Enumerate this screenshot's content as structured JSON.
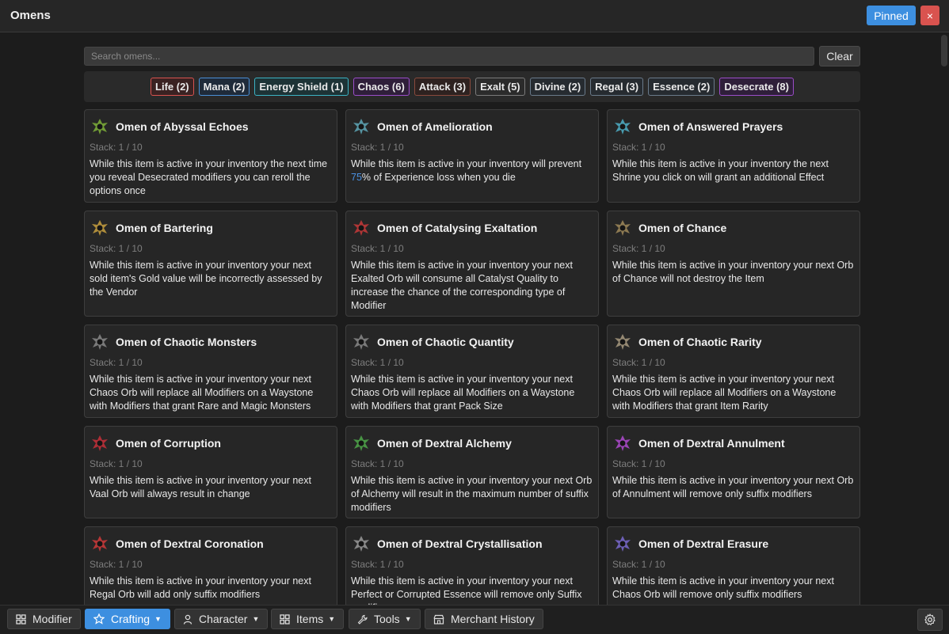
{
  "app": {
    "title": "Omens",
    "pinned_label": "Pinned",
    "close_label": "×"
  },
  "search": {
    "placeholder": "Search omens...",
    "value": "",
    "clear_label": "Clear"
  },
  "filters": [
    {
      "label": "Life (2)",
      "color": "#d9534f",
      "bg": "#3a2222"
    },
    {
      "label": "Mana (2)",
      "color": "#4a8fd6",
      "bg": "#1f2b3a"
    },
    {
      "label": "Energy Shield (1)",
      "color": "#3bb3c4",
      "bg": "#1d3336"
    },
    {
      "label": "Chaos (6)",
      "color": "#9b4dc9",
      "bg": "#2f1f3a"
    },
    {
      "label": "Attack (3)",
      "color": "#8a4a3c",
      "bg": "#2e2220"
    },
    {
      "label": "Exalt (5)",
      "color": "#7a7a7a",
      "bg": "#2b2b2b"
    },
    {
      "label": "Divine (2)",
      "color": "#6a7a8a",
      "bg": "#262b30"
    },
    {
      "label": "Regal (3)",
      "color": "#6a7a8a",
      "bg": "#262b30"
    },
    {
      "label": "Essence (2)",
      "color": "#6a7a8a",
      "bg": "#262b30"
    },
    {
      "label": "Desecrate (8)",
      "color": "#9b4dc9",
      "bg": "#2f1f3a"
    }
  ],
  "omens": [
    {
      "name": "Omen of Abyssal Echoes",
      "stack": "Stack: 1 / 10",
      "desc": "While this item is active in your inventory the next time you reveal Desecrated modifiers you can reroll the options once",
      "icon": "abyssal-echoes-icon",
      "icon_color": "#7fb23a"
    },
    {
      "name": "Omen of Amelioration",
      "stack": "Stack: 1 / 10",
      "desc_before": "While this item is active in your inventory will prevent ",
      "desc_hl": "75",
      "desc_after": "% of Experience loss when you die",
      "icon": "amelioration-icon",
      "icon_color": "#5fa8b8"
    },
    {
      "name": "Omen of Answered Prayers",
      "stack": "Stack: 1 / 10",
      "desc": "While this item is active in your inventory the next Shrine you click on will grant an additional Effect",
      "icon": "answered-prayers-icon",
      "icon_color": "#4fb0c8"
    },
    {
      "name": "Omen of Bartering",
      "stack": "Stack: 1 / 10",
      "desc": "While this item is active in your inventory your next sold item's Gold value will be incorrectly assessed by the Vendor",
      "icon": "bartering-icon",
      "icon_color": "#c8a040"
    },
    {
      "name": "Omen of Catalysing Exaltation",
      "stack": "Stack: 1 / 10",
      "desc": "While this item is active in your inventory your next Exalted Orb will consume all Catalyst Quality to increase the chance of the corresponding type of Modifier",
      "icon": "catalysing-exaltation-icon",
      "icon_color": "#c83a3a"
    },
    {
      "name": "Omen of Chance",
      "stack": "Stack: 1 / 10",
      "desc": "While this item is active in your inventory your next Orb of Chance will not destroy the Item",
      "icon": "chance-icon",
      "icon_color": "#a08a5a"
    },
    {
      "name": "Omen of Chaotic Monsters",
      "stack": "Stack: 1 / 10",
      "desc": "While this item is active in your inventory your next Chaos Orb will replace all Modifiers on a Waystone with Modifiers that grant Rare and Magic Monsters",
      "icon": "chaotic-monsters-icon",
      "icon_color": "#8a8a8a"
    },
    {
      "name": "Omen of Chaotic Quantity",
      "stack": "Stack: 1 / 10",
      "desc": "While this item is active in your inventory your next Chaos Orb will replace all Modifiers on a Waystone with Modifiers that grant Pack Size",
      "icon": "chaotic-quantity-icon",
      "icon_color": "#8a8a8a"
    },
    {
      "name": "Omen of Chaotic Rarity",
      "stack": "Stack: 1 / 10",
      "desc": "While this item is active in your inventory your next Chaos Orb will replace all Modifiers on a Waystone with Modifiers that grant Item Rarity",
      "icon": "chaotic-rarity-icon",
      "icon_color": "#a89a80"
    },
    {
      "name": "Omen of Corruption",
      "stack": "Stack: 1 / 10",
      "desc": "While this item is active in your inventory your next Vaal Orb will always result in change",
      "icon": "corruption-icon",
      "icon_color": "#c8303a"
    },
    {
      "name": "Omen of Dextral Alchemy",
      "stack": "Stack: 1 / 10",
      "desc": "While this item is active in your inventory your next Orb of Alchemy will result in the maximum number of suffix modifiers",
      "icon": "dextral-alchemy-icon",
      "icon_color": "#4fa84a"
    },
    {
      "name": "Omen of Dextral Annulment",
      "stack": "Stack: 1 / 10",
      "desc": "While this item is active in your inventory your next Orb of Annulment will remove only suffix modifiers",
      "icon": "dextral-annulment-icon",
      "icon_color": "#b04ad0"
    },
    {
      "name": "Omen of Dextral Coronation",
      "stack": "Stack: 1 / 10",
      "desc": "While this item is active in your inventory your next Regal Orb will add only suffix modifiers",
      "icon": "dextral-coronation-icon",
      "icon_color": "#d03a3a"
    },
    {
      "name": "Omen of Dextral Crystallisation",
      "stack": "Stack: 1 / 10",
      "desc": "While this item is active in your inventory your next Perfect or Corrupted Essence will remove only Suffix modifiers",
      "icon": "dextral-crystallisation-icon",
      "icon_color": "#9a9a9a"
    },
    {
      "name": "Omen of Dextral Erasure",
      "stack": "Stack: 1 / 10",
      "desc": "While this item is active in your inventory your next Chaos Orb will remove only suffix modifiers",
      "icon": "dextral-erasure-icon",
      "icon_color": "#7a6ad0"
    }
  ],
  "nav": {
    "modifier": "Modifier",
    "crafting": "Crafting",
    "character": "Character",
    "items": "Items",
    "tools": "Tools",
    "merchant": "Merchant History"
  }
}
